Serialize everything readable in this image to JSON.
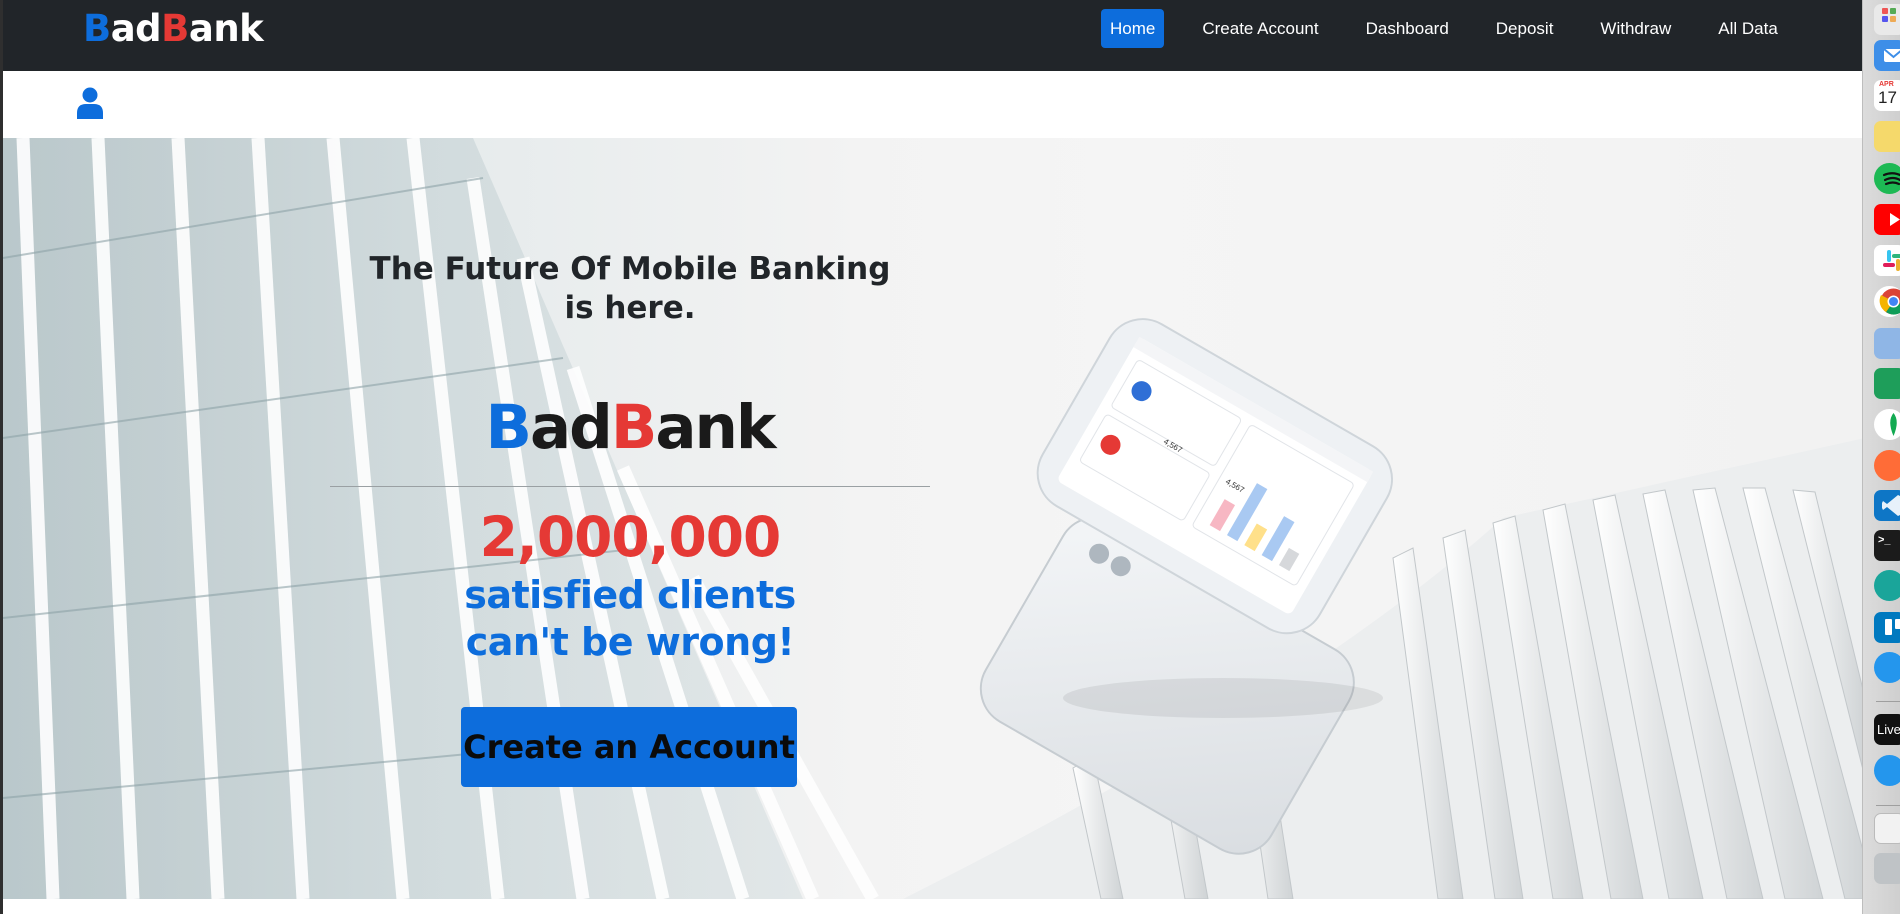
{
  "navbar": {
    "brand": {
      "letter1": "B",
      "part1": "ad",
      "letter2": "B",
      "part2": "ank"
    },
    "links": [
      {
        "label": "Home",
        "active": true
      },
      {
        "label": "Create Account",
        "active": false
      },
      {
        "label": "Dashboard",
        "active": false
      },
      {
        "label": "Deposit",
        "active": false
      },
      {
        "label": "Withdraw",
        "active": false
      },
      {
        "label": "All Data",
        "active": false
      }
    ]
  },
  "userbar": {
    "icon": "user-icon"
  },
  "hero": {
    "tagline": "The Future Of Mobile Banking is here.",
    "logo": {
      "letter1": "B",
      "part1": "ad",
      "letter2": "B",
      "part2": "ank"
    },
    "stat_number": "2,000,000",
    "stat_text_line1": "satisfied clients",
    "stat_text_line2": "can't be wrong!",
    "cta_label": "Create an Account",
    "phone_screen": {
      "card1_value": "4,567",
      "card2_value": "4,567"
    }
  },
  "dock": {
    "calendar_month": "APR",
    "calendar_day": "17",
    "live_label": "Live"
  },
  "colors": {
    "brand_blue": "#0d6ddc",
    "brand_red": "#e53935",
    "navbar_bg": "#212529"
  }
}
